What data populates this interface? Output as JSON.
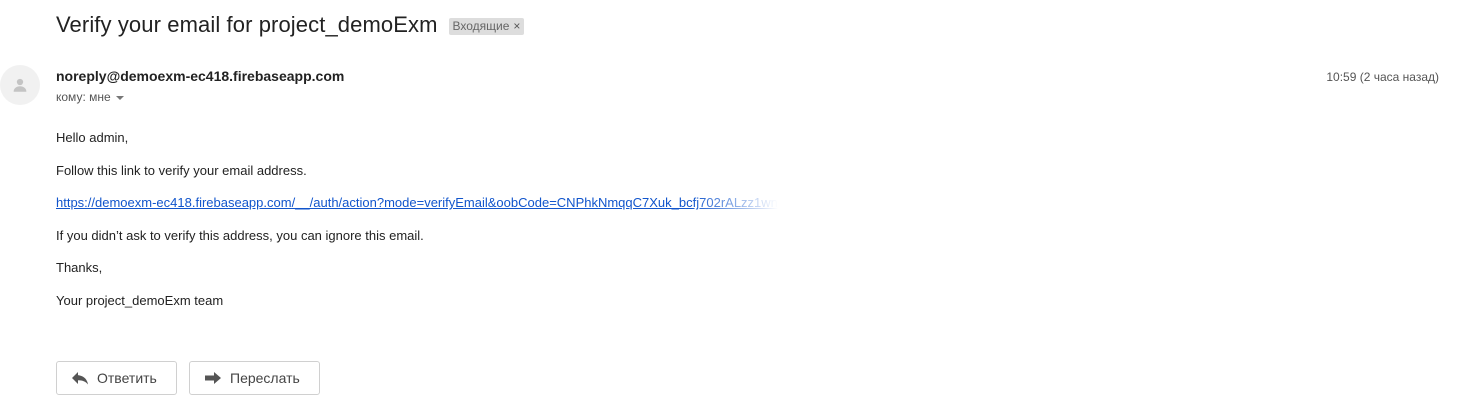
{
  "email": {
    "subject": "Verify your email for project_demoExm",
    "label": "Входящие",
    "label_close": "×",
    "sender": "noreply@demoexm-ec418.firebaseapp.com",
    "recipient": "кому: мне",
    "timestamp": "10:59 (2 часа назад)",
    "body": {
      "greeting": "Hello admin,",
      "instruction": "Follow this link to verify your email address.",
      "link": "https://demoexm-ec418.firebaseapp.com/__/auth/action?mode=verifyEmail&oobCode=CNPhkNmqqC7Xuk_bcfj702rALzz1wn",
      "ignore_note": "If you didn’t ask to verify this address, you can ignore this email.",
      "thanks": "Thanks,",
      "signature": "Your project_demoExm team"
    }
  },
  "actions": {
    "reply_label": "Ответить",
    "forward_label": "Переслать"
  },
  "icons": {
    "avatar": "person-avatar-icon",
    "reply": "reply-arrow-icon",
    "forward": "forward-arrow-icon",
    "recipient_details": "caret-down-icon"
  },
  "colors": {
    "link": "#1155cc",
    "label_bg": "#dddddd",
    "text": "#222222",
    "muted": "#555555"
  }
}
